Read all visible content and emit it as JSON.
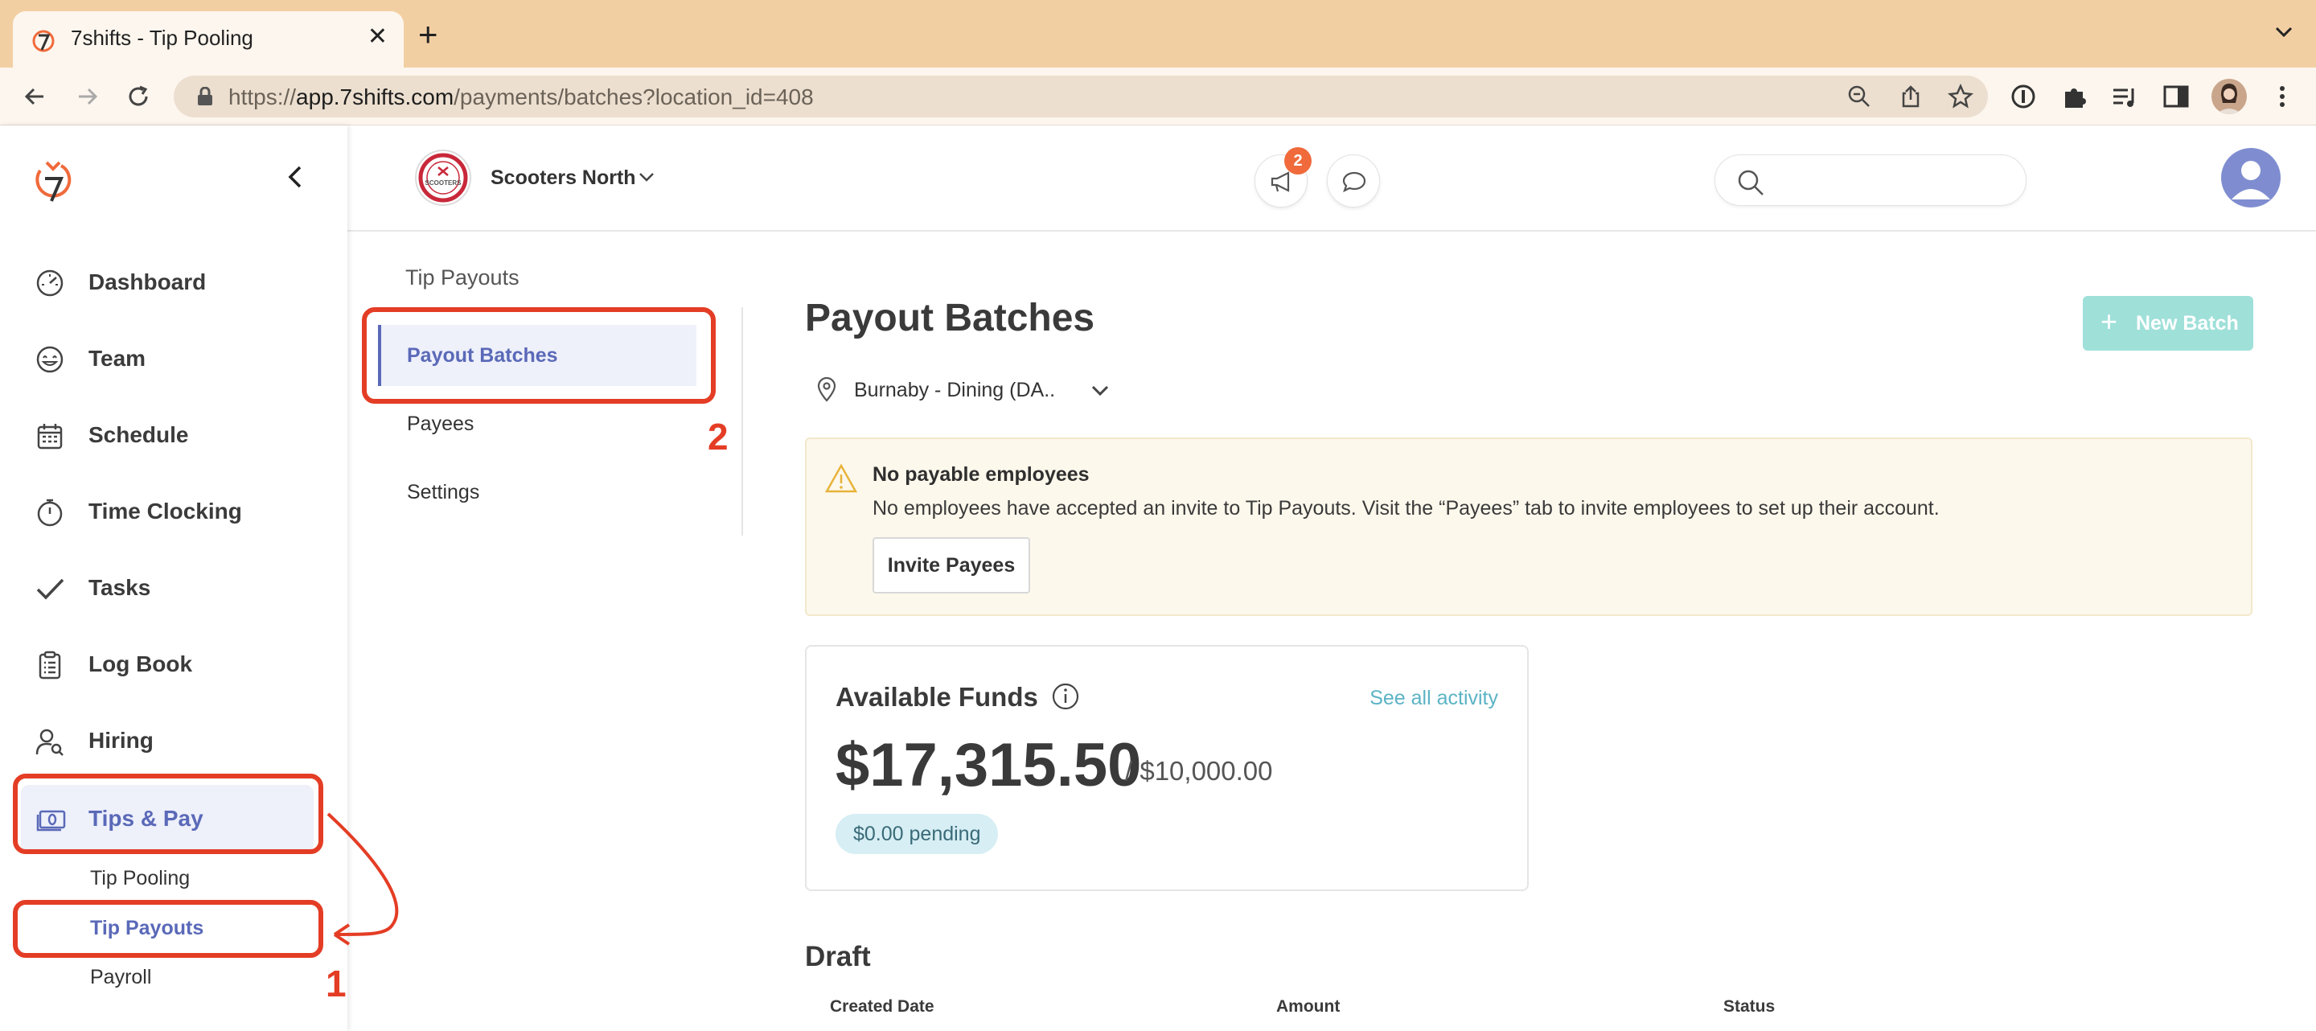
{
  "browser": {
    "tab_title": "7shifts - Tip Pooling",
    "url_prefix": "https://",
    "url_host": "app.7shifts.com",
    "url_path": "/payments/batches?location_id=408"
  },
  "sidebar": {
    "items": [
      {
        "label": "Dashboard",
        "icon": "gauge-icon"
      },
      {
        "label": "Team",
        "icon": "smiley-icon"
      },
      {
        "label": "Schedule",
        "icon": "calendar-icon"
      },
      {
        "label": "Time Clocking",
        "icon": "stopwatch-icon"
      },
      {
        "label": "Tasks",
        "icon": "checkmark-icon"
      },
      {
        "label": "Log Book",
        "icon": "clipboard-icon"
      },
      {
        "label": "Hiring",
        "icon": "person-search-icon"
      },
      {
        "label": "Tips & Pay",
        "icon": "money-icon"
      }
    ],
    "sub_items": [
      "Tip Pooling",
      "Tip Payouts",
      "Payroll"
    ]
  },
  "header": {
    "location_name": "Scooters North",
    "location_logo_text": "SCOOTERS",
    "notification_count": "2"
  },
  "subnav": {
    "title": "Tip Payouts",
    "items": [
      "Payout Batches",
      "Payees",
      "Settings"
    ]
  },
  "main": {
    "title": "Payout Batches",
    "new_batch_label": "New Batch",
    "location_filter": "Burnaby - Dining (DA..",
    "alert": {
      "title": "No payable employees",
      "message": "No employees have accepted an invite to Tip Payouts. Visit the “Payees” tab to invite employees to set up their account.",
      "button": "Invite Payees"
    },
    "funds": {
      "title": "Available Funds",
      "link": "See all activity",
      "amount": "$17,315.50",
      "limit": "/ $10,000.00",
      "pending": "$0.00 pending"
    },
    "draft": {
      "title": "Draft",
      "columns": [
        "Created Date",
        "Amount",
        "Status"
      ]
    }
  },
  "annotations": {
    "step1": "1",
    "step2": "2"
  },
  "colors": {
    "accent": "#5a69b8",
    "annotation": "#e43d25",
    "primary_button": "#9fe0d9",
    "brand_orange": "#f06a3b"
  }
}
